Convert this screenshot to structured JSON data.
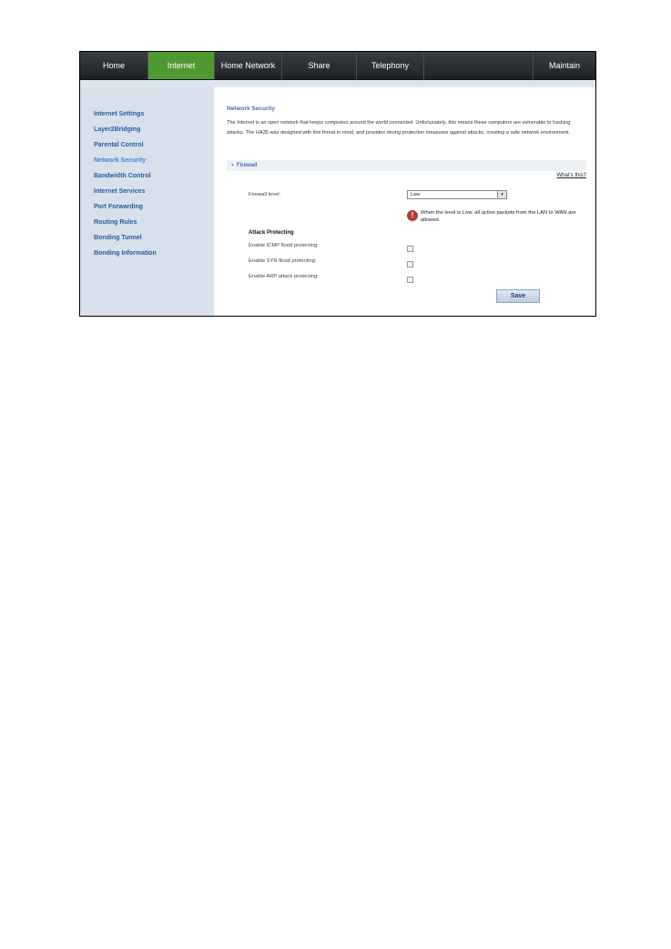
{
  "topnav": {
    "tabs": [
      {
        "label": "Home"
      },
      {
        "label": "Internet"
      },
      {
        "label": "Home Network"
      },
      {
        "label": "Share"
      },
      {
        "label": "Telephony"
      },
      {
        "label": "Maintain"
      }
    ],
    "active_color": "#4f9a30"
  },
  "sidebar": {
    "items": [
      {
        "label": "Internet Settings"
      },
      {
        "label": "Layer2Bridging"
      },
      {
        "label": "Parental Control"
      },
      {
        "label": "Network Security"
      },
      {
        "label": "Bandwidth Control"
      },
      {
        "label": "Internet Services"
      },
      {
        "label": "Port Forwarding"
      },
      {
        "label": "Routing Rules"
      },
      {
        "label": "Bonding Tunnel"
      },
      {
        "label": "Bonding Information"
      }
    ]
  },
  "main": {
    "title": "Network Security",
    "intro": "The Internet is an open network that keeps computers around the world connected. Unfortunately, this means these computers are vulnerable to hacking attacks. The HA35 was designed with this threat in mind, and provides strong protection measures against attacks, creating a safe network environment.",
    "section_title": "Firewall",
    "whats_this": "What's this?",
    "firewall_level_label": "Firewall level:",
    "firewall_level_value": "Low",
    "warning": "When the level is Low, all active packets from the LAN to WAN are allowed.",
    "attack_heading": "Attack Protecting",
    "options": [
      {
        "label": "Enable ICMP flood protecting:"
      },
      {
        "label": "Enable SYN flood protecting:"
      },
      {
        "label": "Enable ARP attack protecting:"
      }
    ],
    "save_label": "Save"
  }
}
